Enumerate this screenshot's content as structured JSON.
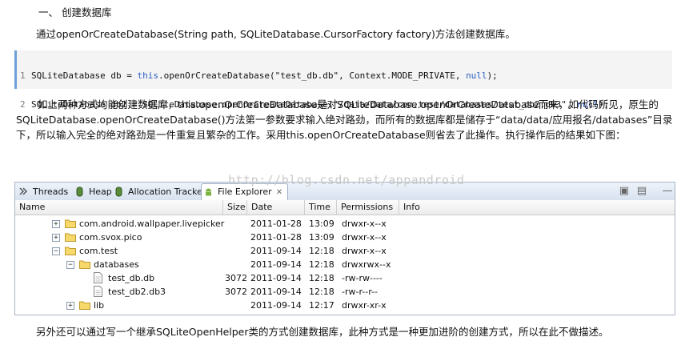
{
  "article": {
    "heading": "一、 创建数据库",
    "para1": "通过openOrCreateDatabase(String path, SQLiteDatabase.CursorFactory factory)方法创建数据库。",
    "code": [
      {
        "num": "1",
        "pre": "SQLiteDatabase db = ",
        "kw": "this",
        "mid": ".openOrCreateDatabase(\"test_db.db\", Context.MODE_PRIVATE, ",
        "kw2": "null",
        "post": ");"
      },
      {
        "num": "2",
        "pre": "SQLiteDatabase db2 = SQLiteDatabase.openOrCreateDatabase(\"/data/data/com.test/databases/test_db2.db3\", ",
        "kw": "",
        "mid": "",
        "kw2": "null",
        "post": ");"
      }
    ],
    "para2": "如上两种方式均能创建数据库，this.openOrCreateDatabase是对SQLiteDatabase.openOrCreateDatabase而来，如代码所见，原生的SQLiteDatabase.openOrCreateDatabase()方法第一参数要求输入绝对路劲，而所有的数据库都是储存于“data/data/应用报名/databases”目录下，所以输入完全的绝对路劲是一件重复且繁杂的工作。采用this.openOrCreateDatabase则省去了此操作。执行操作后的结果如下图：",
    "para3": "另外还可以通过写一个继承SQLiteOpenHelper类的方式创建数据库，此种方式是一种更加进阶的创建方式，所以在此不做描述。",
    "watermark": "http://blog.csdn.net/appandroid"
  },
  "explorer": {
    "tabs": [
      {
        "label": "Threads",
        "icon": "threads-icon"
      },
      {
        "label": "Heap",
        "icon": "heap-icon"
      },
      {
        "label": "Allocation Tracker",
        "icon": "allocation-tracker-icon"
      },
      {
        "label": "File Explorer",
        "icon": "android-icon",
        "active": true
      }
    ],
    "columns": [
      "Name",
      "Size",
      "Date",
      "Time",
      "Permissions",
      "Info"
    ],
    "rows": [
      {
        "name": "com.android.wallpaper.livepicker",
        "size": "",
        "date": "2011-01-28",
        "time": "13:09",
        "perm": "drwxr-x--x",
        "type": "folder",
        "expander": "+",
        "depth": 1
      },
      {
        "name": "com.svox.pico",
        "size": "",
        "date": "2011-01-28",
        "time": "13:09",
        "perm": "drwxr-x--x",
        "type": "folder",
        "expander": "+",
        "depth": 1
      },
      {
        "name": "com.test",
        "size": "",
        "date": "2011-09-14",
        "time": "12:18",
        "perm": "drwxr-x--x",
        "type": "folder",
        "expander": "-",
        "depth": 1
      },
      {
        "name": "databases",
        "size": "",
        "date": "2011-09-14",
        "time": "12:18",
        "perm": "drwxrwx--x",
        "type": "folder",
        "expander": "-",
        "depth": 2
      },
      {
        "name": "test_db.db",
        "size": "3072",
        "date": "2011-09-14",
        "time": "12:18",
        "perm": "-rw-rw----",
        "type": "file",
        "expander": "",
        "depth": 3
      },
      {
        "name": "test_db2.db3",
        "size": "3072",
        "date": "2011-09-14",
        "time": "12:18",
        "perm": "-rw-r--r--",
        "type": "file",
        "expander": "",
        "depth": 3
      },
      {
        "name": "lib",
        "size": "",
        "date": "2011-09-14",
        "time": "12:17",
        "perm": "drwxr-xr-x",
        "type": "folder",
        "expander": "+",
        "depth": 2
      }
    ]
  }
}
